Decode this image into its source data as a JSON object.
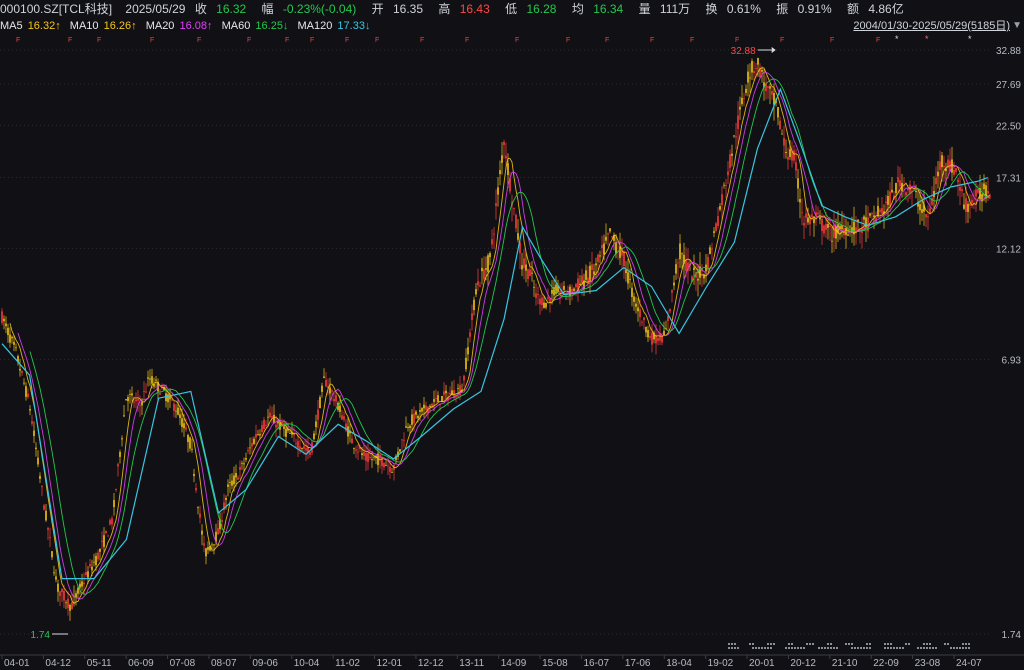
{
  "header": {
    "symbol": "000100.SZ[TCL科技]",
    "date": "2025/05/29",
    "close_label": "收",
    "close": "16.32",
    "change_label": "幅",
    "change": "-0.23%(-0.04)",
    "open_label": "开",
    "open": "16.35",
    "high_label": "高",
    "high": "16.43",
    "low_label": "低",
    "low": "16.28",
    "avg_label": "均",
    "avg": "16.34",
    "vol_label": "量",
    "vol": "111万",
    "turnover_label": "换",
    "turnover": "0.61%",
    "amp_label": "振",
    "amp": "0.91%",
    "amount_label": "额",
    "amount": "4.86亿"
  },
  "ma_bar": {
    "ma5_label": "MA5",
    "ma5": "16.32↑",
    "ma10_label": "MA10",
    "ma10": "16.26↑",
    "ma20_label": "MA20",
    "ma20": "16.08↑",
    "ma60_label": "MA60",
    "ma60": "16.25↓",
    "ma120_label": "MA120",
    "ma120": "17.33↓",
    "range": "2004/01/30-2025/05/29(5185日)"
  },
  "colors": {
    "background": "#111115",
    "up": "#ff3b3b",
    "down": "#f5c518",
    "ma5": "#f5f5f5",
    "ma10": "#f5c518",
    "ma20": "#e040fb",
    "ma60": "#24c74e",
    "ma120": "#39c5e0",
    "grid": "#2a2d33",
    "axis_text": "#b6bac2"
  },
  "chart_data": {
    "type": "candlestick",
    "scale": "log",
    "y_ticks": [
      "32.88",
      "27.69",
      "22.50",
      "17.31",
      "12.12",
      "6.93",
      "1.74"
    ],
    "ylim": [
      1.74,
      32.88
    ],
    "x_ticks": [
      "04-01",
      "04-12",
      "05-11",
      "06-09",
      "07-08",
      "08-07",
      "09-06",
      "10-04",
      "11-02",
      "12-01",
      "12-12",
      "13-11",
      "14-09",
      "15-08",
      "16-07",
      "17-06",
      "18-04",
      "19-02",
      "20-01",
      "20-12",
      "21-10",
      "22-09",
      "23-08",
      "24-07"
    ],
    "max_annotation": "32.88",
    "min_annotation": "1.74",
    "series": [
      {
        "name": "price",
        "x": [
          2004.0,
          2004.3,
          2004.6,
          2004.9,
          2005.2,
          2005.5,
          2005.8,
          2006.1,
          2006.4,
          2006.7,
          2007.0,
          2007.2,
          2007.5,
          2007.8,
          2008.1,
          2008.4,
          2008.7,
          2008.9,
          2009.2,
          2009.5,
          2009.8,
          2010.1,
          2010.4,
          2010.7,
          2011.0,
          2011.3,
          2011.6,
          2011.9,
          2012.2,
          2012.5,
          2012.8,
          2013.1,
          2013.4,
          2013.7,
          2014.0,
          2014.3,
          2014.6,
          2014.9,
          2015.1,
          2015.3,
          2015.45,
          2015.6,
          2015.8,
          2016.0,
          2016.3,
          2016.6,
          2016.9,
          2017.2,
          2017.5,
          2017.7,
          2017.9,
          2018.1,
          2018.4,
          2018.7,
          2019.0,
          2019.3,
          2019.6,
          2019.9,
          2020.2,
          2020.4,
          2020.6,
          2020.8,
          2021.0,
          2021.2,
          2021.4,
          2021.7,
          2022.0,
          2022.3,
          2022.6,
          2022.9,
          2023.2,
          2023.5,
          2023.8,
          2024.1,
          2024.4,
          2024.7,
          2024.9,
          2025.1,
          2025.4
        ],
        "values": [
          8.6,
          7.2,
          5.5,
          3.4,
          2.2,
          2.0,
          2.3,
          2.6,
          3.1,
          5.8,
          5.5,
          6.3,
          5.9,
          5.4,
          4.5,
          2.6,
          2.9,
          3.6,
          4.0,
          4.7,
          5.2,
          4.9,
          4.6,
          4.3,
          6.3,
          5.5,
          4.6,
          4.2,
          4.2,
          4.0,
          5.0,
          5.3,
          5.6,
          5.8,
          6.0,
          10.0,
          11.5,
          21.0,
          15.0,
          11.2,
          10.8,
          9.5,
          9.2,
          9.8,
          9.7,
          10.2,
          11.0,
          13.0,
          11.5,
          9.5,
          8.5,
          7.7,
          7.8,
          12.0,
          10.5,
          11.0,
          15.0,
          21.0,
          29.0,
          31.0,
          27.0,
          25.0,
          20.0,
          19.0,
          14.0,
          14.0,
          13.0,
          13.5,
          13.4,
          14.0,
          15.0,
          17.0,
          16.0,
          14.0,
          19.0,
          18.0,
          15.0,
          15.5,
          16.3
        ]
      },
      {
        "name": "MA120",
        "x": [
          2004.0,
          2004.6,
          2005.3,
          2006.0,
          2006.7,
          2007.4,
          2008.1,
          2008.7,
          2009.3,
          2010.0,
          2010.6,
          2011.3,
          2011.9,
          2012.5,
          2013.1,
          2013.8,
          2014.4,
          2014.9,
          2015.3,
          2015.7,
          2016.2,
          2016.9,
          2017.5,
          2018.1,
          2018.7,
          2019.3,
          2019.9,
          2020.4,
          2020.9,
          2021.3,
          2021.8,
          2022.3,
          2022.8,
          2023.4,
          2024.0,
          2024.6,
          2025.2,
          2025.4
        ],
        "values": [
          7.5,
          6.4,
          2.3,
          2.3,
          2.8,
          5.7,
          5.9,
          3.2,
          3.6,
          4.7,
          4.3,
          5.0,
          4.6,
          4.2,
          4.7,
          5.4,
          5.9,
          8.5,
          13.5,
          11.5,
          9.6,
          9.8,
          11.0,
          10.0,
          7.9,
          10.0,
          12.5,
          20.0,
          27.0,
          21.0,
          15.0,
          14.2,
          13.6,
          14.2,
          15.5,
          16.5,
          17.0,
          17.3
        ]
      }
    ]
  }
}
